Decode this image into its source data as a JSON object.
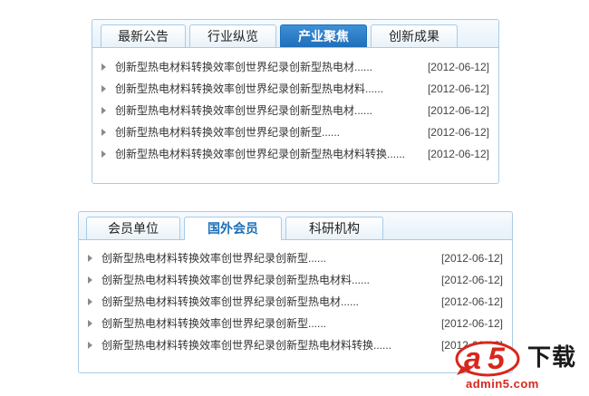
{
  "news_panel": {
    "tabs": [
      {
        "label": "最新公告"
      },
      {
        "label": "行业纵览"
      },
      {
        "label": "产业聚焦",
        "active": true
      },
      {
        "label": "创新成果"
      }
    ],
    "items": [
      {
        "title": "创新型热电材料转换效率创世界纪录创新型热电材......",
        "date": "[2012-06-12]"
      },
      {
        "title": "创新型热电材料转换效率创世界纪录创新型热电材料......",
        "date": "[2012-06-12]"
      },
      {
        "title": "创新型热电材料转换效率创世界纪录创新型热电材......",
        "date": "[2012-06-12]"
      },
      {
        "title": "创新型热电材料转换效率创世界纪录创新型......",
        "date": "[2012-06-12]"
      },
      {
        "title": "创新型热电材料转换效率创世界纪录创新型热电材料转换......",
        "date": "[2012-06-12]"
      }
    ]
  },
  "member_panel": {
    "tabs": [
      {
        "label": "会员单位"
      },
      {
        "label": "国外会员",
        "active": true
      },
      {
        "label": "科研机构"
      }
    ],
    "items": [
      {
        "title": "创新型热电材料转换效率创世界纪录创新型......",
        "date": "[2012-06-12]"
      },
      {
        "title": "创新型热电材料转换效率创世界纪录创新型热电材料......",
        "date": "[2012-06-12]"
      },
      {
        "title": "创新型热电材料转换效率创世界纪录创新型热电材......",
        "date": "[2012-06-12]"
      },
      {
        "title": "创新型热电材料转换效率创世界纪录创新型......",
        "date": "[2012-06-12]"
      },
      {
        "title": "创新型热电材料转换效率创世界纪录创新型热电材料转换......",
        "date": "[2012-06-12]"
      }
    ]
  },
  "watermark": {
    "brand": "a5",
    "text": "下载",
    "site": "admin5.com"
  },
  "colors": {
    "border": "#a9cbe6",
    "active_tab": "#1f6fb9",
    "active_tab_text_bottom": "#1a6fb8",
    "watermark_red": "#d9261c"
  }
}
